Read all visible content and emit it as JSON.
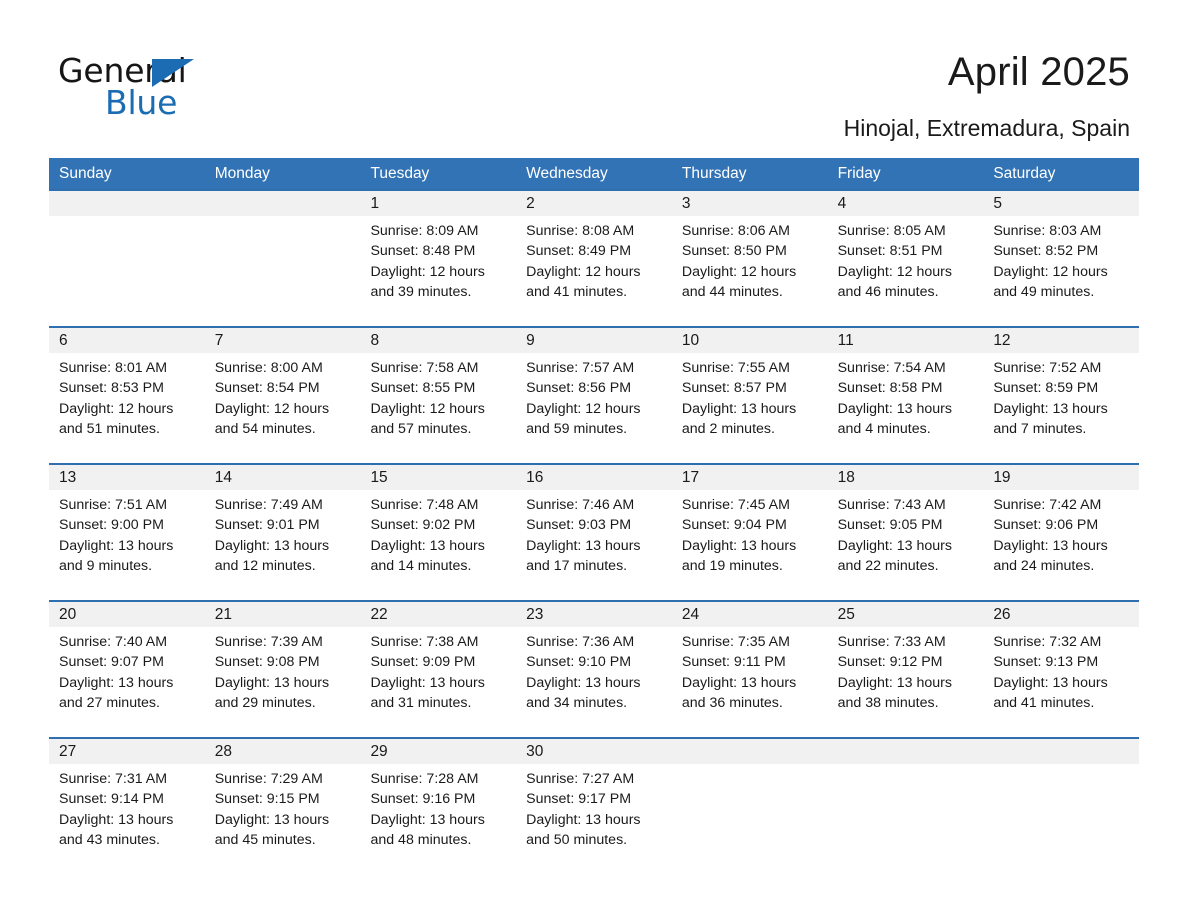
{
  "brand": {
    "name_part1": "General",
    "name_part2": "Blue",
    "logo_icon": "triangle-icon",
    "accent_color": "#1b6cb3"
  },
  "header": {
    "title": "April 2025",
    "location": "Hinojal, Extremadura, Spain"
  },
  "colors": {
    "header_blue": "#3273b5",
    "rule_blue": "#2f6fb0",
    "date_band_gray": "#f1f1f1",
    "text": "#1a1a1a"
  },
  "calendar": {
    "weekday_headers": [
      "Sunday",
      "Monday",
      "Tuesday",
      "Wednesday",
      "Thursday",
      "Friday",
      "Saturday"
    ],
    "weeks": [
      {
        "days": [
          {
            "date": "",
            "sunrise": "",
            "sunset": "",
            "daylight_line1": "",
            "daylight_line2": ""
          },
          {
            "date": "",
            "sunrise": "",
            "sunset": "",
            "daylight_line1": "",
            "daylight_line2": ""
          },
          {
            "date": "1",
            "sunrise": "Sunrise: 8:09 AM",
            "sunset": "Sunset: 8:48 PM",
            "daylight_line1": "Daylight: 12 hours",
            "daylight_line2": "and 39 minutes."
          },
          {
            "date": "2",
            "sunrise": "Sunrise: 8:08 AM",
            "sunset": "Sunset: 8:49 PM",
            "daylight_line1": "Daylight: 12 hours",
            "daylight_line2": "and 41 minutes."
          },
          {
            "date": "3",
            "sunrise": "Sunrise: 8:06 AM",
            "sunset": "Sunset: 8:50 PM",
            "daylight_line1": "Daylight: 12 hours",
            "daylight_line2": "and 44 minutes."
          },
          {
            "date": "4",
            "sunrise": "Sunrise: 8:05 AM",
            "sunset": "Sunset: 8:51 PM",
            "daylight_line1": "Daylight: 12 hours",
            "daylight_line2": "and 46 minutes."
          },
          {
            "date": "5",
            "sunrise": "Sunrise: 8:03 AM",
            "sunset": "Sunset: 8:52 PM",
            "daylight_line1": "Daylight: 12 hours",
            "daylight_line2": "and 49 minutes."
          }
        ]
      },
      {
        "days": [
          {
            "date": "6",
            "sunrise": "Sunrise: 8:01 AM",
            "sunset": "Sunset: 8:53 PM",
            "daylight_line1": "Daylight: 12 hours",
            "daylight_line2": "and 51 minutes."
          },
          {
            "date": "7",
            "sunrise": "Sunrise: 8:00 AM",
            "sunset": "Sunset: 8:54 PM",
            "daylight_line1": "Daylight: 12 hours",
            "daylight_line2": "and 54 minutes."
          },
          {
            "date": "8",
            "sunrise": "Sunrise: 7:58 AM",
            "sunset": "Sunset: 8:55 PM",
            "daylight_line1": "Daylight: 12 hours",
            "daylight_line2": "and 57 minutes."
          },
          {
            "date": "9",
            "sunrise": "Sunrise: 7:57 AM",
            "sunset": "Sunset: 8:56 PM",
            "daylight_line1": "Daylight: 12 hours",
            "daylight_line2": "and 59 minutes."
          },
          {
            "date": "10",
            "sunrise": "Sunrise: 7:55 AM",
            "sunset": "Sunset: 8:57 PM",
            "daylight_line1": "Daylight: 13 hours",
            "daylight_line2": "and 2 minutes."
          },
          {
            "date": "11",
            "sunrise": "Sunrise: 7:54 AM",
            "sunset": "Sunset: 8:58 PM",
            "daylight_line1": "Daylight: 13 hours",
            "daylight_line2": "and 4 minutes."
          },
          {
            "date": "12",
            "sunrise": "Sunrise: 7:52 AM",
            "sunset": "Sunset: 8:59 PM",
            "daylight_line1": "Daylight: 13 hours",
            "daylight_line2": "and 7 minutes."
          }
        ]
      },
      {
        "days": [
          {
            "date": "13",
            "sunrise": "Sunrise: 7:51 AM",
            "sunset": "Sunset: 9:00 PM",
            "daylight_line1": "Daylight: 13 hours",
            "daylight_line2": "and 9 minutes."
          },
          {
            "date": "14",
            "sunrise": "Sunrise: 7:49 AM",
            "sunset": "Sunset: 9:01 PM",
            "daylight_line1": "Daylight: 13 hours",
            "daylight_line2": "and 12 minutes."
          },
          {
            "date": "15",
            "sunrise": "Sunrise: 7:48 AM",
            "sunset": "Sunset: 9:02 PM",
            "daylight_line1": "Daylight: 13 hours",
            "daylight_line2": "and 14 minutes."
          },
          {
            "date": "16",
            "sunrise": "Sunrise: 7:46 AM",
            "sunset": "Sunset: 9:03 PM",
            "daylight_line1": "Daylight: 13 hours",
            "daylight_line2": "and 17 minutes."
          },
          {
            "date": "17",
            "sunrise": "Sunrise: 7:45 AM",
            "sunset": "Sunset: 9:04 PM",
            "daylight_line1": "Daylight: 13 hours",
            "daylight_line2": "and 19 minutes."
          },
          {
            "date": "18",
            "sunrise": "Sunrise: 7:43 AM",
            "sunset": "Sunset: 9:05 PM",
            "daylight_line1": "Daylight: 13 hours",
            "daylight_line2": "and 22 minutes."
          },
          {
            "date": "19",
            "sunrise": "Sunrise: 7:42 AM",
            "sunset": "Sunset: 9:06 PM",
            "daylight_line1": "Daylight: 13 hours",
            "daylight_line2": "and 24 minutes."
          }
        ]
      },
      {
        "days": [
          {
            "date": "20",
            "sunrise": "Sunrise: 7:40 AM",
            "sunset": "Sunset: 9:07 PM",
            "daylight_line1": "Daylight: 13 hours",
            "daylight_line2": "and 27 minutes."
          },
          {
            "date": "21",
            "sunrise": "Sunrise: 7:39 AM",
            "sunset": "Sunset: 9:08 PM",
            "daylight_line1": "Daylight: 13 hours",
            "daylight_line2": "and 29 minutes."
          },
          {
            "date": "22",
            "sunrise": "Sunrise: 7:38 AM",
            "sunset": "Sunset: 9:09 PM",
            "daylight_line1": "Daylight: 13 hours",
            "daylight_line2": "and 31 minutes."
          },
          {
            "date": "23",
            "sunrise": "Sunrise: 7:36 AM",
            "sunset": "Sunset: 9:10 PM",
            "daylight_line1": "Daylight: 13 hours",
            "daylight_line2": "and 34 minutes."
          },
          {
            "date": "24",
            "sunrise": "Sunrise: 7:35 AM",
            "sunset": "Sunset: 9:11 PM",
            "daylight_line1": "Daylight: 13 hours",
            "daylight_line2": "and 36 minutes."
          },
          {
            "date": "25",
            "sunrise": "Sunrise: 7:33 AM",
            "sunset": "Sunset: 9:12 PM",
            "daylight_line1": "Daylight: 13 hours",
            "daylight_line2": "and 38 minutes."
          },
          {
            "date": "26",
            "sunrise": "Sunrise: 7:32 AM",
            "sunset": "Sunset: 9:13 PM",
            "daylight_line1": "Daylight: 13 hours",
            "daylight_line2": "and 41 minutes."
          }
        ]
      },
      {
        "days": [
          {
            "date": "27",
            "sunrise": "Sunrise: 7:31 AM",
            "sunset": "Sunset: 9:14 PM",
            "daylight_line1": "Daylight: 13 hours",
            "daylight_line2": "and 43 minutes."
          },
          {
            "date": "28",
            "sunrise": "Sunrise: 7:29 AM",
            "sunset": "Sunset: 9:15 PM",
            "daylight_line1": "Daylight: 13 hours",
            "daylight_line2": "and 45 minutes."
          },
          {
            "date": "29",
            "sunrise": "Sunrise: 7:28 AM",
            "sunset": "Sunset: 9:16 PM",
            "daylight_line1": "Daylight: 13 hours",
            "daylight_line2": "and 48 minutes."
          },
          {
            "date": "30",
            "sunrise": "Sunrise: 7:27 AM",
            "sunset": "Sunset: 9:17 PM",
            "daylight_line1": "Daylight: 13 hours",
            "daylight_line2": "and 50 minutes."
          },
          {
            "date": "",
            "sunrise": "",
            "sunset": "",
            "daylight_line1": "",
            "daylight_line2": ""
          },
          {
            "date": "",
            "sunrise": "",
            "sunset": "",
            "daylight_line1": "",
            "daylight_line2": ""
          },
          {
            "date": "",
            "sunrise": "",
            "sunset": "",
            "daylight_line1": "",
            "daylight_line2": ""
          }
        ]
      }
    ]
  }
}
